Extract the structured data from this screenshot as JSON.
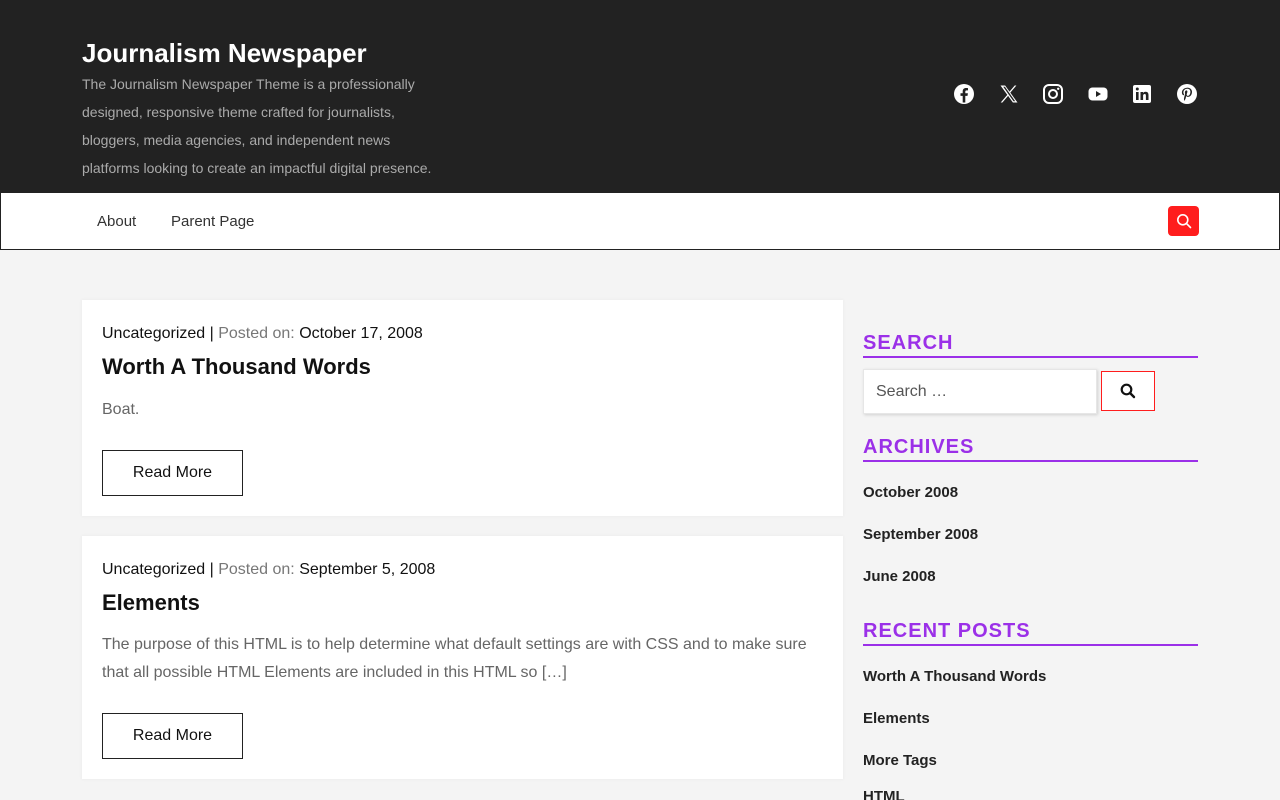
{
  "header": {
    "site_title": "Journalism Newspaper",
    "site_description": "The Journalism Newspaper Theme is a professionally designed, responsive theme crafted for journalists, bloggers, media agencies, and independent news platforms looking to create an impactful digital presence.",
    "social_icons": [
      "facebook-icon",
      "x-twitter-icon",
      "instagram-icon",
      "youtube-icon",
      "linkedin-icon",
      "pinterest-icon"
    ]
  },
  "nav": {
    "items": [
      {
        "label": "About"
      },
      {
        "label": "Parent Page"
      }
    ],
    "search_icon": "search-icon"
  },
  "posts": [
    {
      "category": "Uncategorized",
      "separator": "|",
      "posted_label": "Posted on:",
      "date": "October 17, 2008",
      "title": "Worth A Thousand Words",
      "excerpt": "Boat.",
      "read_more": "Read More"
    },
    {
      "category": "Uncategorized",
      "separator": "|",
      "posted_label": "Posted on:",
      "date": "September 5, 2008",
      "title": "Elements",
      "excerpt": "The purpose of this HTML is to help determine what default settings are with CSS and to make sure that all possible HTML Elements are included in this HTML so […]",
      "read_more": "Read More"
    }
  ],
  "sidebar": {
    "search": {
      "title": "SEARCH",
      "placeholder": "Search …"
    },
    "archives": {
      "title": "ARCHIVES",
      "items": [
        "October 2008",
        "September 2008",
        "June 2008"
      ]
    },
    "recent_posts": {
      "title": "RECENT POSTS",
      "items": [
        "Worth A Thousand Words",
        "Elements",
        "More Tags",
        "HTML"
      ]
    }
  },
  "colors": {
    "header_bg": "#222222",
    "accent_red": "#ff1d1d",
    "accent_purple": "#9b30e8"
  }
}
